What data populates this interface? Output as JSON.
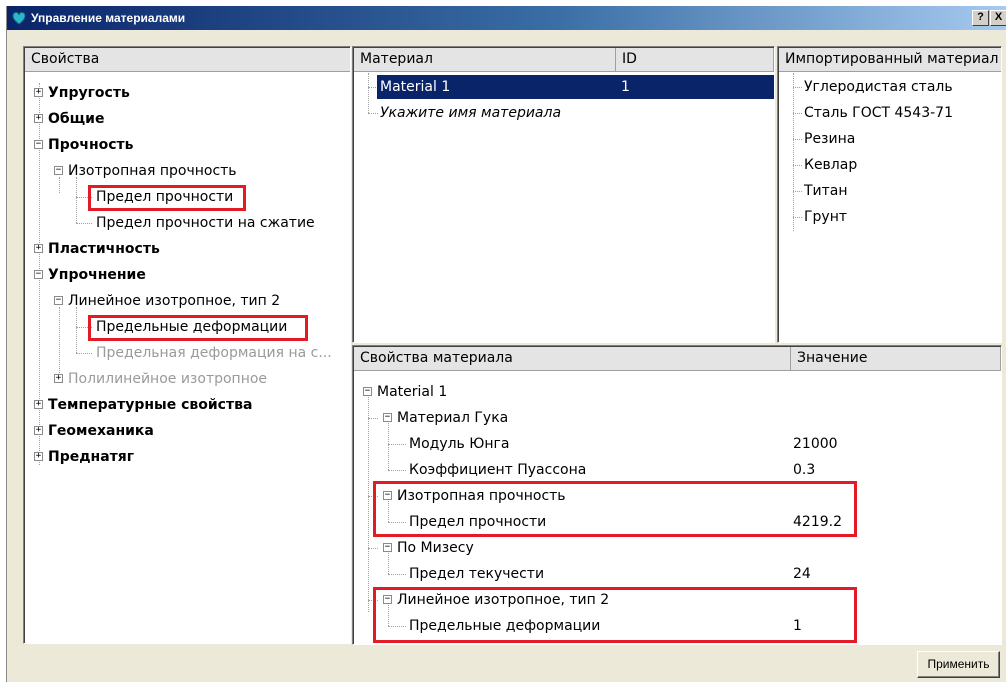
{
  "window": {
    "title": "Управление материалами",
    "help": "?",
    "close": "X"
  },
  "properties_tree": {
    "header": "Свойства",
    "items": [
      "Упругость",
      "Общие",
      "Прочность",
      "Изотропная прочность",
      "Предел прочности",
      "Предел прочности на сжатие",
      "Пластичность",
      "Упрочнение",
      "Линейное изотропное, тип 2",
      "Предельные деформации",
      "Предельная деформация на с...",
      "Полилинейное изотропное",
      "Температурные свойства",
      "Геомеханика",
      "Преднатяг"
    ]
  },
  "materials_list": {
    "col_material": "Материал",
    "col_id": "ID",
    "rows": [
      {
        "name": "Material 1",
        "id": "1"
      }
    ],
    "placeholder": "Укажите имя материала"
  },
  "imported": {
    "header": "Импортированный материал",
    "items": [
      "Углеродистая сталь",
      "Сталь ГОСТ 4543-71",
      "Резина",
      "Кевлар",
      "Титан",
      "Грунт"
    ]
  },
  "material_props": {
    "col_property": "Свойства материала",
    "col_value": "Значение",
    "rows": [
      {
        "label": "Material 1",
        "value": ""
      },
      {
        "label": "Материал Гука",
        "value": ""
      },
      {
        "label": "Модуль Юнга",
        "value": "21000"
      },
      {
        "label": "Коэффициент Пуассона",
        "value": "0.3"
      },
      {
        "label": "Изотропная прочность",
        "value": ""
      },
      {
        "label": "Предел прочности",
        "value": "4219.2"
      },
      {
        "label": "По Мизесу",
        "value": ""
      },
      {
        "label": "Предел текучести",
        "value": "24"
      },
      {
        "label": "Линейное изотропное, тип 2",
        "value": ""
      },
      {
        "label": "Предельные деформации",
        "value": "1"
      }
    ]
  },
  "apply_button": "Применить",
  "colors": {
    "highlight": "#e21b24",
    "selection": "#0a246a"
  }
}
